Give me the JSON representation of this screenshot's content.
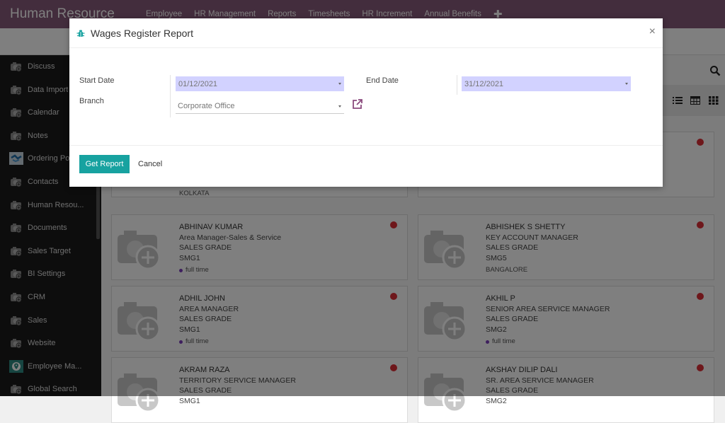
{
  "topbar": {
    "app_title": "Human Resource",
    "nav": [
      "Employee",
      "HR Management",
      "Reports",
      "Timesheets",
      "HR Increment",
      "Annual Benefits"
    ],
    "add_icon": "plus-icon"
  },
  "sidebar": {
    "items": [
      {
        "label": "Discuss",
        "icon": "camera-icon"
      },
      {
        "label": "Data Import",
        "icon": "camera-icon"
      },
      {
        "label": "Calendar",
        "icon": "camera-icon"
      },
      {
        "label": "Notes",
        "icon": "camera-icon"
      },
      {
        "label": "Ordering Po...",
        "icon": "handshake-icon"
      },
      {
        "label": "Contacts",
        "icon": "camera-icon"
      },
      {
        "label": "Human Resou...",
        "icon": "camera-icon"
      },
      {
        "label": "Documents",
        "icon": "camera-icon"
      },
      {
        "label": "Sales Target",
        "icon": "camera-icon"
      },
      {
        "label": "BI Settings",
        "icon": "camera-icon"
      },
      {
        "label": "CRM",
        "icon": "camera-icon"
      },
      {
        "label": "Sales",
        "icon": "camera-icon"
      },
      {
        "label": "Website",
        "icon": "camera-icon"
      },
      {
        "label": "Employee Ma...",
        "icon": "map-pin-icon"
      },
      {
        "label": "Global Search",
        "icon": "camera-icon"
      }
    ]
  },
  "cards": [
    {
      "name": "",
      "lines": [
        "......"
      ],
      "city": "KOLKATA",
      "tag": null
    },
    {
      "name": "",
      "lines": [
        "......"
      ],
      "city": null,
      "tag": null
    },
    {
      "name": "ABHINAV KUMAR",
      "lines": [
        "Area Manager-Sales & Service",
        "SALES GRADE",
        "SMG1"
      ],
      "tag": "full time",
      "city": null
    },
    {
      "name": "ABHISHEK S SHETTY",
      "lines": [
        "KEY ACCOUNT MANAGER",
        "SALES GRADE",
        "SMG5"
      ],
      "tag": null,
      "city": "BANGALORE"
    },
    {
      "name": "ADHIL JOHN",
      "lines": [
        "AREA MANAGER",
        "SALES GRADE",
        "SMG1"
      ],
      "tag": "full time",
      "city": null
    },
    {
      "name": "AKHIL P",
      "lines": [
        "SENIOR AREA SERVICE MANAGER",
        "SALES GRADE",
        "SMG2"
      ],
      "tag": "full time",
      "city": null
    },
    {
      "name": "AKRAM RAZA",
      "lines": [
        "TERRITORY SERVICE MANAGER",
        "SALES GRADE",
        "SMG1"
      ],
      "tag": null,
      "city": null
    },
    {
      "name": "AKSHAY DILIP DALI",
      "lines": [
        "SR. AREA SERVICE MANAGER",
        "SALES GRADE",
        "SMG2"
      ],
      "tag": null,
      "city": null
    }
  ],
  "modal": {
    "title": "Wages Register Report",
    "close_label": "×",
    "start_date_label": "Start Date",
    "start_date_value": "01/12/2021",
    "end_date_label": "End Date",
    "end_date_value": "31/12/2021",
    "branch_label": "Branch",
    "branch_value": "Corporate Office",
    "get_report_label": "Get Report",
    "cancel_label": "Cancel"
  },
  "colors": {
    "topbar": "#875a7b",
    "primary_button": "#17a2a0",
    "date_highlight": "#d2d2ff",
    "status_red": "#dc2e37",
    "tag_purple": "#7c3ebd"
  }
}
